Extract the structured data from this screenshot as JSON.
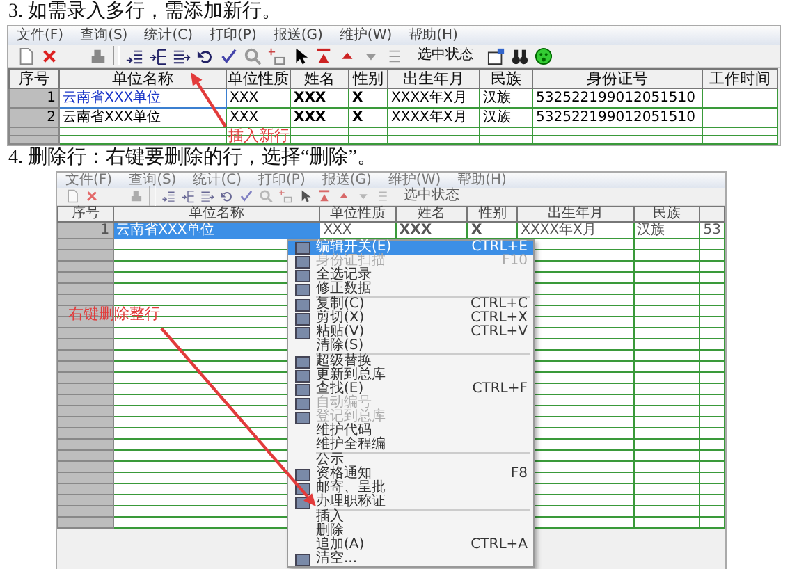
{
  "steps": [
    {
      "number": "3.",
      "text": "如需录入多行，需添加新行。",
      "window": {
        "menu": [
          "文件(F)",
          "查询(S)",
          "统计(C)",
          "打印(P)",
          "报送(G)",
          "维护(W)",
          "帮助(H)"
        ],
        "toolbar_label": "选中状态",
        "columns": [
          "序号",
          "单位名称",
          "单位性质",
          "姓名",
          "性别",
          "出生年月",
          "民族",
          "身份证号",
          "工作时间"
        ],
        "rows": [
          {
            "selected": true,
            "cells": [
              "1",
              "云南省XXX单位",
              "XXX",
              "XXX",
              "X",
              "XXXX年X月",
              "汉族",
              "532522199012051510"
            ]
          },
          {
            "selected": false,
            "cells": [
              "2",
              "云南省XXX单位",
              "XXX",
              "XXX",
              "X",
              "XXXX年X月",
              "汉族",
              "532522199012051510"
            ]
          }
        ],
        "annotation": "插入新行"
      }
    },
    {
      "number": "4.",
      "text": "删除行：右键要删除的行，选择“删除”。",
      "window": {
        "menu": [
          "文件(F)",
          "查询(S)",
          "统计(C)",
          "打印(P)",
          "报送(G)",
          "维护(W)",
          "帮助(H)"
        ],
        "toolbar_label": "选中状态",
        "columns": [
          "序号",
          "单位名称",
          "单位性质",
          "姓名",
          "性别",
          "出生年月",
          "民族"
        ],
        "rows": [
          {
            "selected": true,
            "cells": [
              "1",
              "云南省XXX单位",
              "XXX",
              "XXX",
              "X",
              "XXXX年X月",
              "汉族",
              "53"
            ]
          }
        ],
        "context_menu": [
          {
            "kind": "item",
            "label": "编辑开关(E)",
            "shortcut": "CTRL+E",
            "selected": true,
            "disabled": false,
            "icon": true
          },
          {
            "kind": "item",
            "label": "身份证扫描",
            "shortcut": "F10",
            "selected": false,
            "disabled": true,
            "icon": true
          },
          {
            "kind": "item",
            "label": "全选记录",
            "selected": false,
            "disabled": false,
            "icon": true
          },
          {
            "kind": "item",
            "label": "修正数据",
            "selected": false,
            "disabled": false,
            "icon": true
          },
          {
            "kind": "separator"
          },
          {
            "kind": "item",
            "label": "复制(C)",
            "shortcut": "CTRL+C",
            "selected": false,
            "disabled": false,
            "icon": true
          },
          {
            "kind": "item",
            "label": "剪切(X)",
            "shortcut": "CTRL+X",
            "selected": false,
            "disabled": false,
            "icon": true
          },
          {
            "kind": "item",
            "label": "粘贴(V)",
            "shortcut": "CTRL+V",
            "selected": false,
            "disabled": false,
            "icon": true
          },
          {
            "kind": "item",
            "label": "清除(S)",
            "selected": false,
            "disabled": false,
            "icon": false
          },
          {
            "kind": "separator"
          },
          {
            "kind": "item",
            "label": "超级替换",
            "selected": false,
            "disabled": false,
            "icon": true
          },
          {
            "kind": "item",
            "label": "更新到总库",
            "selected": false,
            "disabled": false,
            "icon": true
          },
          {
            "kind": "item",
            "label": "查找(E)",
            "shortcut": "CTRL+F",
            "selected": false,
            "disabled": false,
            "icon": true
          },
          {
            "kind": "item",
            "label": "自动编号",
            "selected": false,
            "disabled": true,
            "icon": true
          },
          {
            "kind": "item",
            "label": "登记到总库",
            "selected": false,
            "disabled": true,
            "icon": true
          },
          {
            "kind": "item",
            "label": "维护代码",
            "selected": false,
            "disabled": false,
            "icon": false
          },
          {
            "kind": "item",
            "label": "维护全程编",
            "selected": false,
            "disabled": false,
            "icon": false
          },
          {
            "kind": "separator"
          },
          {
            "kind": "item",
            "label": "公示",
            "selected": false,
            "disabled": false,
            "icon": false
          },
          {
            "kind": "item",
            "label": "资格通知",
            "shortcut": "F8",
            "selected": false,
            "disabled": false,
            "icon": true
          },
          {
            "kind": "item",
            "label": "邮寄、呈批",
            "selected": false,
            "disabled": false,
            "icon": true
          },
          {
            "kind": "item",
            "label": "办理职称证",
            "selected": false,
            "disabled": false,
            "icon": true
          },
          {
            "kind": "separator"
          },
          {
            "kind": "item",
            "label": "插入",
            "selected": false,
            "disabled": false,
            "icon": false
          },
          {
            "kind": "item",
            "label": "删除",
            "selected": false,
            "disabled": false,
            "icon": false
          },
          {
            "kind": "item",
            "label": "追加(A)",
            "shortcut": "CTRL+A",
            "selected": false,
            "disabled": false,
            "icon": false
          },
          {
            "kind": "item",
            "label": "清空...",
            "selected": false,
            "disabled": false,
            "icon": true
          }
        ],
        "annotation": "右键删除整行"
      }
    }
  ]
}
